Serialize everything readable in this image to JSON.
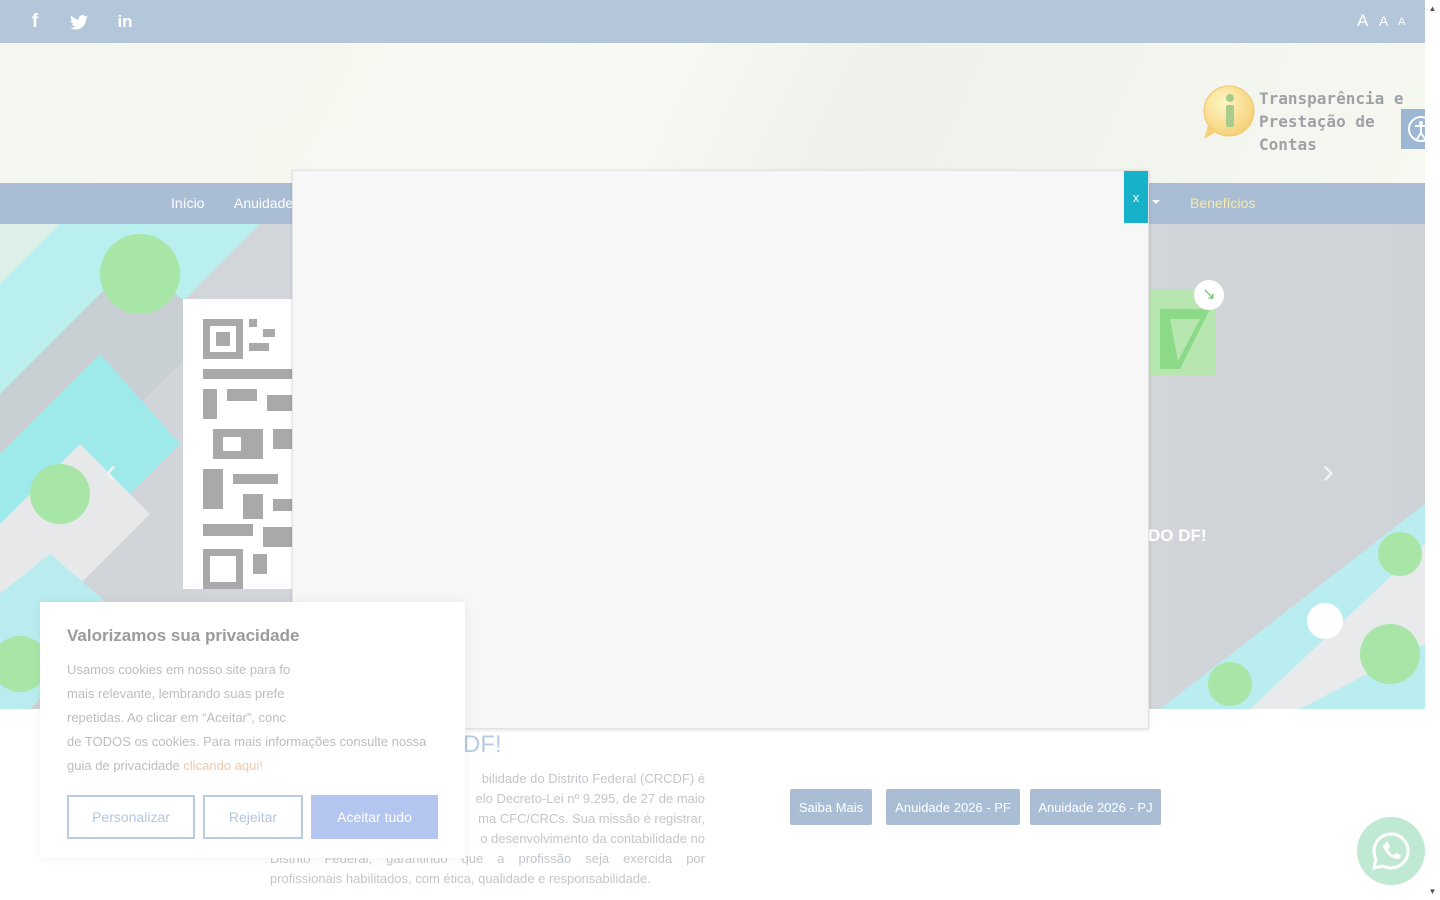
{
  "topbar": {
    "social": [
      {
        "name": "facebook-icon",
        "glyph": "f"
      },
      {
        "name": "twitter-icon",
        "glyph": "🐦"
      },
      {
        "name": "linkedin-icon",
        "glyph": "in"
      }
    ],
    "font_sizes": [
      "A",
      "A",
      "A"
    ]
  },
  "header": {
    "transparency_text": "Transparência e Prestação de Contas"
  },
  "nav": {
    "items": [
      {
        "label": "Início"
      },
      {
        "label": "Anuidade"
      },
      {
        "label": "Benefícios"
      }
    ]
  },
  "hero": {
    "caption": "DO DF!",
    "prev_glyph": "‹",
    "next_glyph": "›",
    "badge_glyph": "↘"
  },
  "about": {
    "title": "DF!",
    "lines": [
      "bilidade do Distrito Federal (CRCDF) é",
      "elo Decreto-Lei nº 9.295, de 27 de maio",
      "ma CFC/CRCs. Sua missão é registrar,",
      "o desenvolvimento da contabilidade no",
      "Distrito Federal, garantindo que a profissão seja exercida por",
      "profissionais habilitados, com ética, qualidade e responsabilidade."
    ]
  },
  "actions": {
    "buttons": [
      {
        "label": "Saiba Mais"
      },
      {
        "label": "Anuidade 2026 - PF"
      },
      {
        "label": "Anuidade 2026 - PJ"
      }
    ]
  },
  "modal": {
    "close_label": "x"
  },
  "cookie": {
    "title": "Valorizamos sua privacidade",
    "body_lines": [
      "Usamos cookies em nosso site para fo",
      "mais relevante, lembrando suas prefe",
      "repetidas. Ao clicar em “Aceitar”, conc",
      "de TODOS os cookies. Para mais informações consulte nossa"
    ],
    "body_tail": "guia de privacidade",
    "link": "clicando aqui!",
    "buttons": {
      "customize": "Personalizar",
      "reject": "Rejeitar",
      "accept": "Aceitar tudo"
    }
  },
  "colors": {
    "topbar": "#b3c6da",
    "nav": "#a9bed5",
    "modal_close": "#17b1c9",
    "accent_nav": "#f7e9a7"
  }
}
